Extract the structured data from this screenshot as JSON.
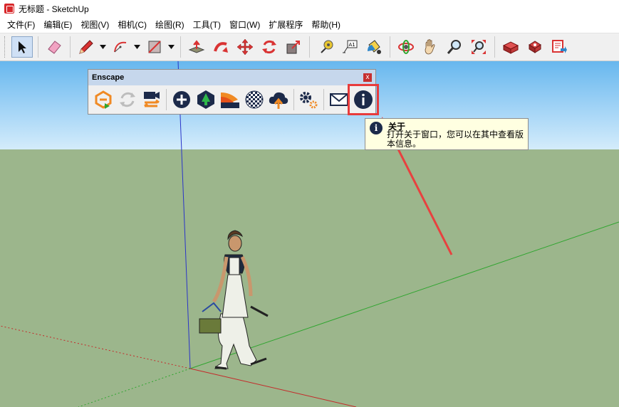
{
  "window": {
    "title": "无标题 - SketchUp"
  },
  "menu": [
    "文件(F)",
    "编辑(E)",
    "视图(V)",
    "相机(C)",
    "绘图(R)",
    "工具(T)",
    "窗口(W)",
    "扩展程序",
    "帮助(H)"
  ],
  "toolbar": {
    "tools": [
      "select-icon",
      "eraser-icon",
      "pencil-icon",
      "arc-icon",
      "rectangle-icon",
      "push-pull-icon",
      "follow-me-icon",
      "move-icon",
      "rotate-icon",
      "scale-icon",
      "tape-measure-icon",
      "text-icon",
      "paint-bucket-icon",
      "orbit-icon",
      "pan-icon",
      "zoom-icon",
      "zoom-extents-icon",
      "warehouse-icon",
      "extension-warehouse-icon",
      "layout-icon"
    ]
  },
  "enscape": {
    "title": "Enscape",
    "close": "x",
    "buttons": [
      "start-enscape-icon",
      "live-update-icon",
      "video-editor-icon",
      "capture-icon",
      "asset-library-icon",
      "material-editor-icon",
      "panorama-icon",
      "upload-icon",
      "settings-icon",
      "feedback-icon",
      "about-icon"
    ]
  },
  "tooltip": {
    "title": "关于",
    "text": "打开关于窗口，您可以在其中查看版本信息。",
    "icon": "info-icon"
  },
  "colors": {
    "sky_top": "#67b7ee",
    "ground": "#9cb68c",
    "highlight": "#e83b3b",
    "axis_blue": "#2a34c8",
    "axis_green": "#2fa52f",
    "axis_red": "#c42a2a"
  }
}
